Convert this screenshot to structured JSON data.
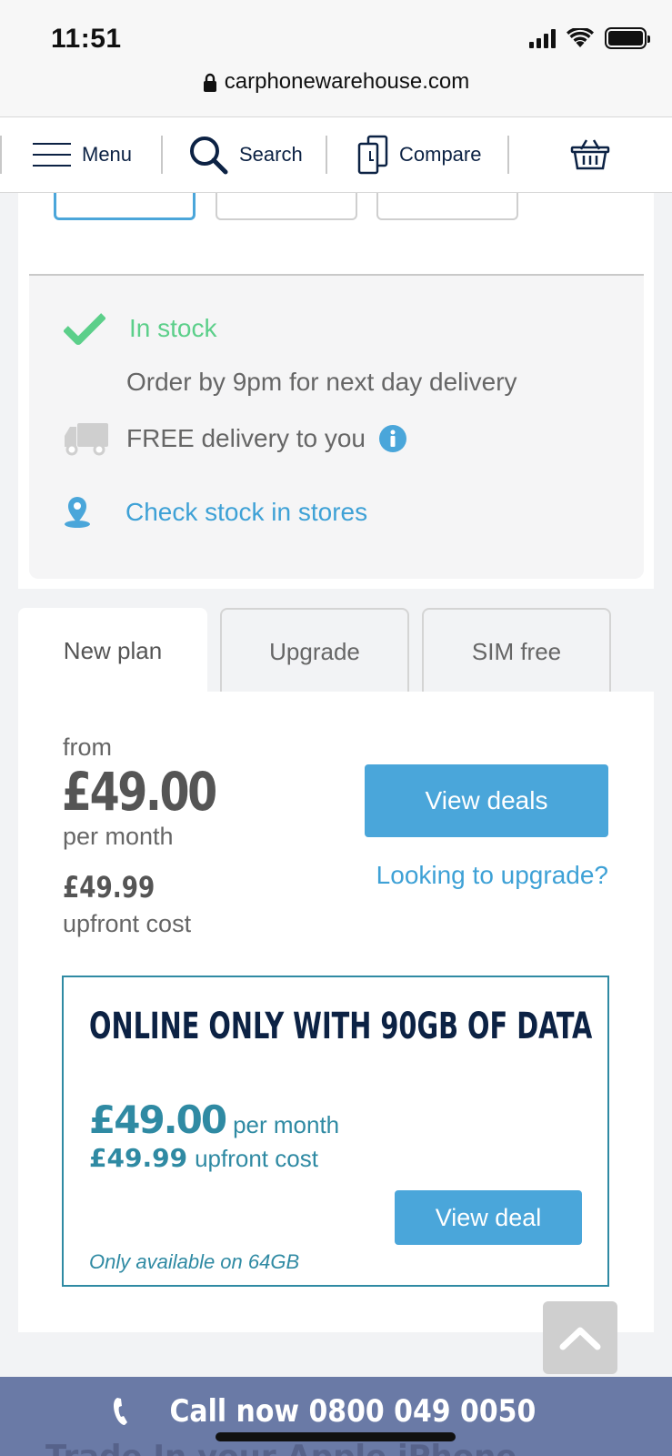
{
  "status": {
    "time": "11:51"
  },
  "browser": {
    "url": "carphonewarehouse.com"
  },
  "nav": {
    "menu": "Menu",
    "search": "Search",
    "compare": "Compare"
  },
  "stock": {
    "in_stock": "In stock",
    "order_by": "Order by 9pm for next day delivery",
    "free_delivery": "FREE delivery to you",
    "check_stores": "Check stock in stores"
  },
  "tabs": [
    {
      "label": "New plan",
      "active": true
    },
    {
      "label": "Upgrade",
      "active": false
    },
    {
      "label": "SIM free",
      "active": false
    }
  ],
  "plan": {
    "from": "from",
    "price": "£49.00",
    "per_month": "per month",
    "upfront_price": "£49.99",
    "upfront_label": "upfront cost",
    "view_deals": "View deals",
    "upgrade_link": "Looking to upgrade?"
  },
  "offer": {
    "title": "ONLINE ONLY WITH 90GB OF DATA",
    "price": "£49.00",
    "per_month": "per month",
    "upfront_price": "£49.99",
    "upfront_label": "upfront cost",
    "button": "View deal",
    "note": "Only available on 64GB"
  },
  "call": {
    "label": "Call now 0800 049 0050",
    "ghost": "Trade In your Apple iPhone"
  },
  "colors": {
    "accent_blue": "#4aa6da",
    "navy": "#0c2244",
    "teal": "#2f8aa3",
    "in_stock_green": "#5ccf8a",
    "call_bar": "#6a7aa6"
  }
}
